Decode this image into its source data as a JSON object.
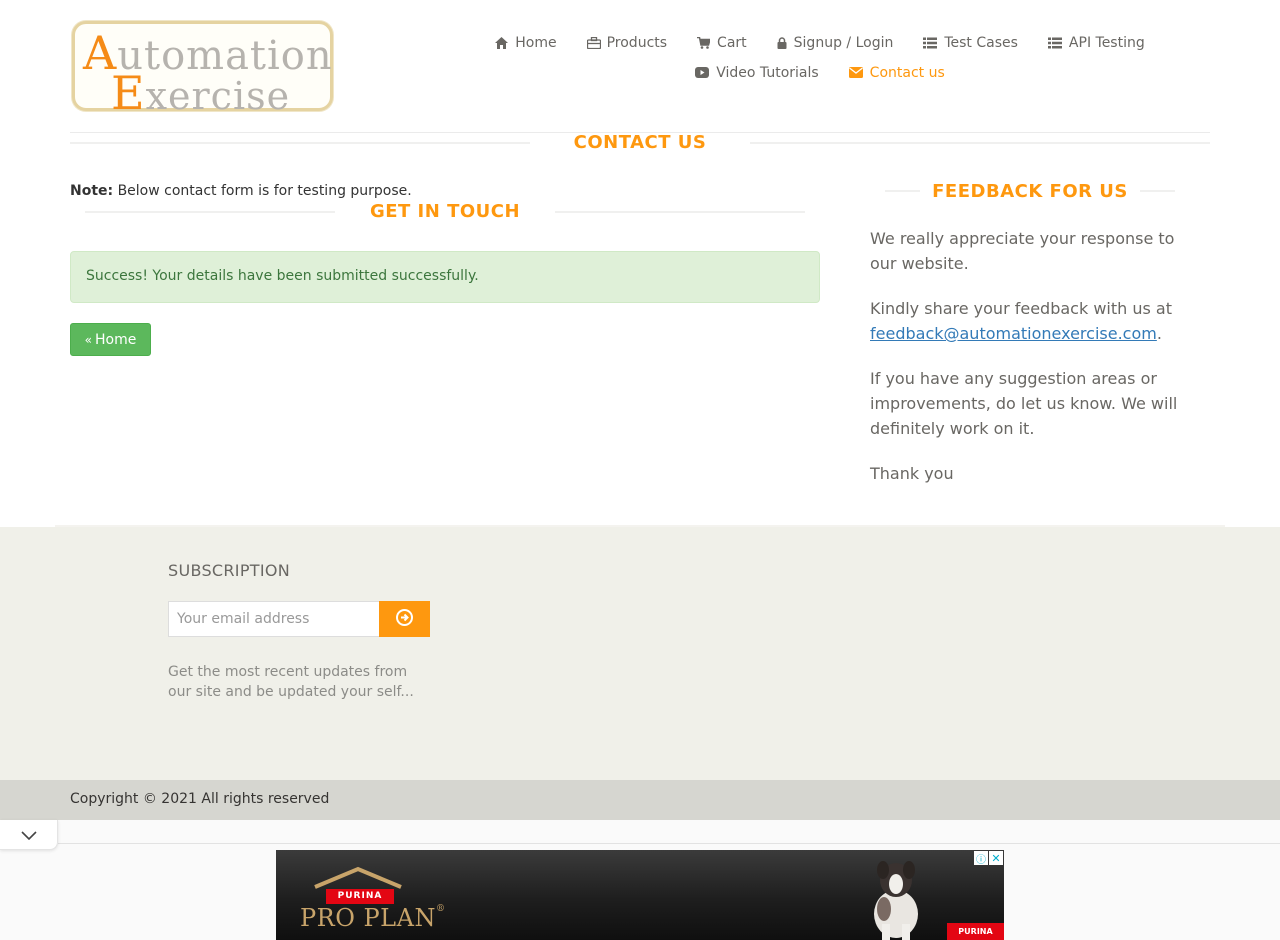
{
  "brand": {
    "logo_line1_cap": "A",
    "logo_line1_rest": "utomation",
    "logo_line2_cap": "E",
    "logo_line2_rest": "xercise",
    "accent": "#fe980f"
  },
  "nav": {
    "items": [
      {
        "label": "Home",
        "icon": "home-icon"
      },
      {
        "label": "Products",
        "icon": "briefcase-icon"
      },
      {
        "label": "Cart",
        "icon": "cart-icon"
      },
      {
        "label": "Signup / Login",
        "icon": "lock-icon"
      },
      {
        "label": "Test Cases",
        "icon": "list-icon"
      },
      {
        "label": "API Testing",
        "icon": "list-icon"
      },
      {
        "label": "Video Tutorials",
        "icon": "youtube-play-icon"
      },
      {
        "label": "Contact us",
        "icon": "envelope-icon",
        "active": true
      }
    ]
  },
  "main": {
    "title": "CONTACT US",
    "note_label": "Note:",
    "note_text": "Below contact form is for testing purpose.",
    "get_in_touch": "GET IN TOUCH",
    "alert": "Success! Your details have been submitted successfully.",
    "home_button": "Home"
  },
  "feedback": {
    "title": "FEEDBACK FOR US",
    "p1": "We really appreciate your response to our website.",
    "p2_prefix": "Kindly share your feedback with us at",
    "email": "feedback@automationexercise.com",
    "p2_suffix": ".",
    "p3": "If you have any suggestion areas or improvements, do let us know. We will definitely work on it.",
    "p4": "Thank you"
  },
  "footer": {
    "subscription_title": "SUBSCRIPTION",
    "email_placeholder": "Your email address",
    "description": "Get the most recent updates from our site and be updated your self...",
    "copyright": "Copyright © 2021 All rights reserved"
  },
  "ad": {
    "brand_badge": "PURINA",
    "product": "PRO PLAN",
    "reg_mark": "®",
    "corner_badge": "PURINA",
    "adchoices_icon": "info-icon",
    "close_icon": "close-icon"
  }
}
